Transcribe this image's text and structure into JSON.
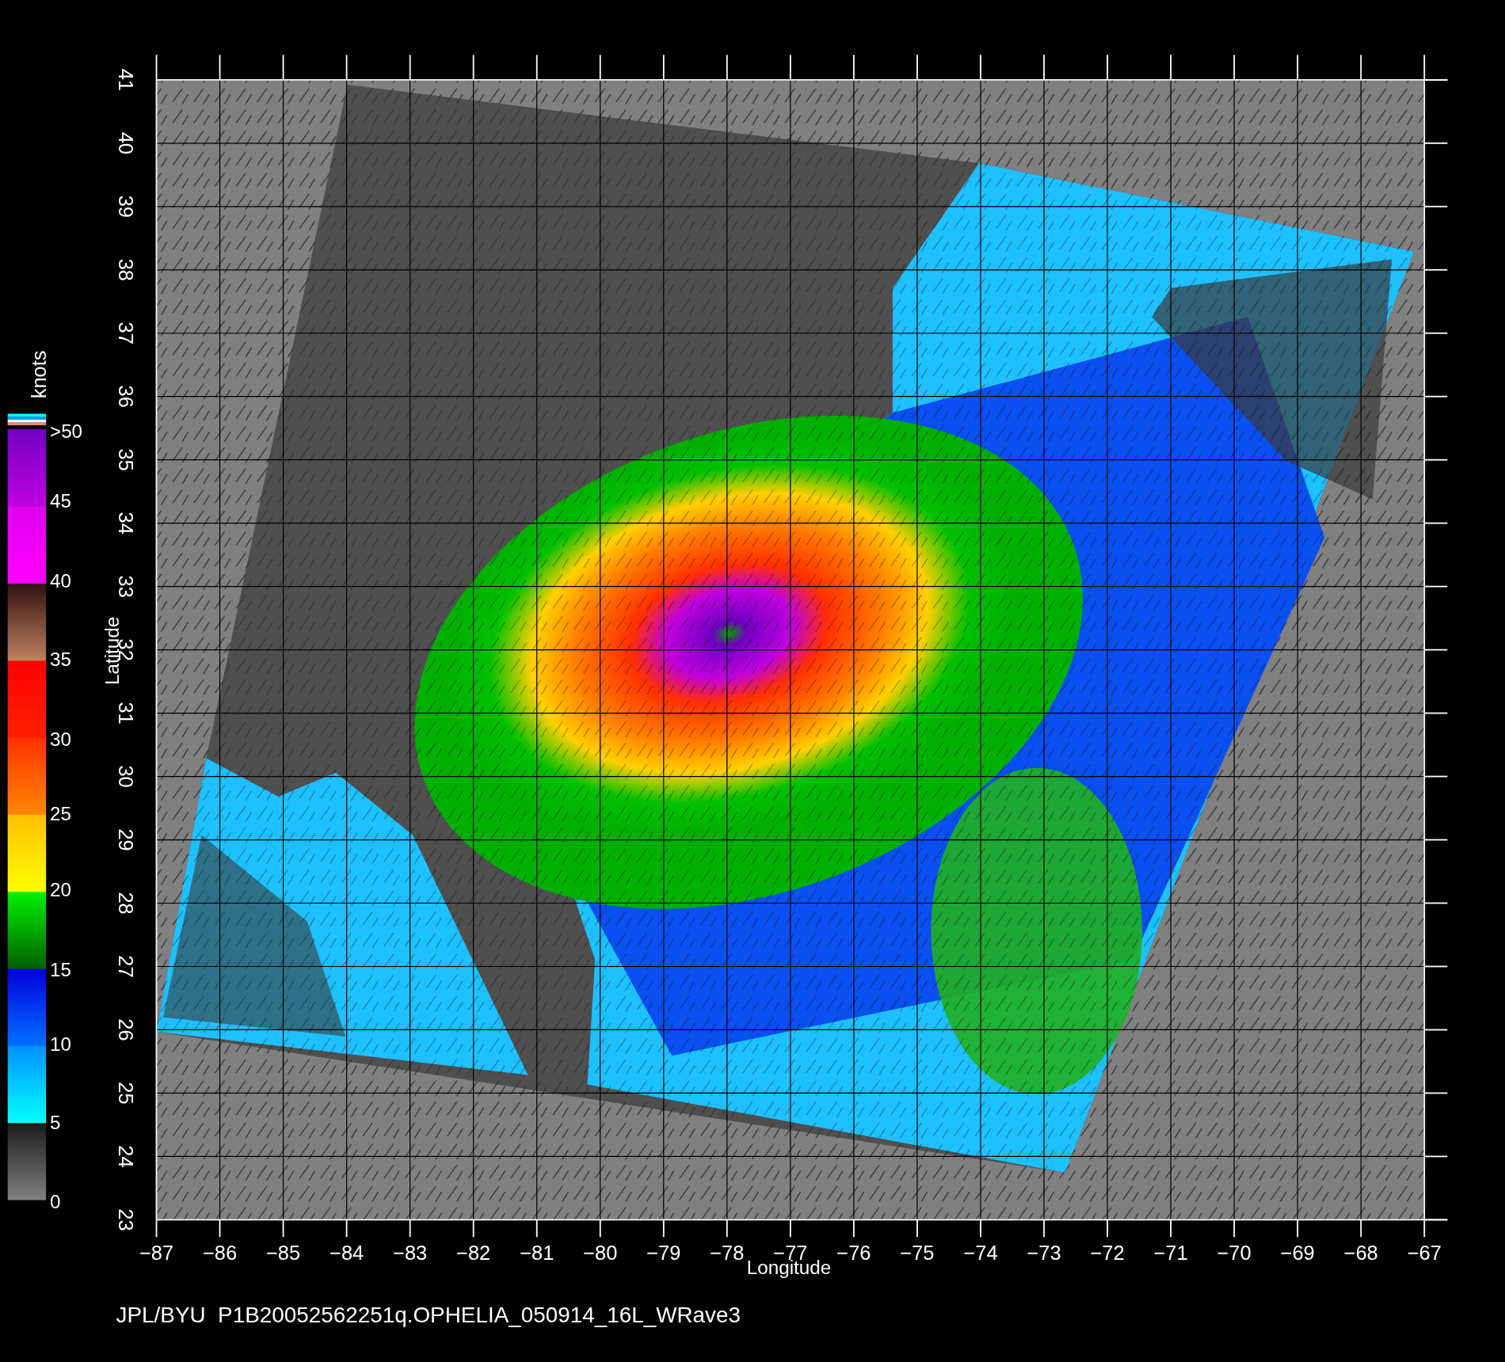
{
  "plot": {
    "xlabel": "Longitude",
    "ylabel": "Latitude",
    "xticks": [
      "−87",
      "−86",
      "−85",
      "−84",
      "−83",
      "−82",
      "−81",
      "−80",
      "−79",
      "−78",
      "−77",
      "−76",
      "−75",
      "−74",
      "−73",
      "−72",
      "−71",
      "−70",
      "−69",
      "−68",
      "−67"
    ],
    "yticks": [
      "23",
      "24",
      "25",
      "26",
      "27",
      "28",
      "29",
      "30",
      "31",
      "32",
      "33",
      "34",
      "35",
      "36",
      "37",
      "38",
      "39",
      "40",
      "41"
    ]
  },
  "colorbar": {
    "unit": "knots",
    "labels": [
      ">50",
      "45",
      "40",
      "35",
      "30",
      "25",
      "20",
      "15",
      "10",
      "5",
      "0"
    ]
  },
  "caption": "JPL/BYU  P1B20052562251q.OPHELIA_050914_16L_WRave3"
}
